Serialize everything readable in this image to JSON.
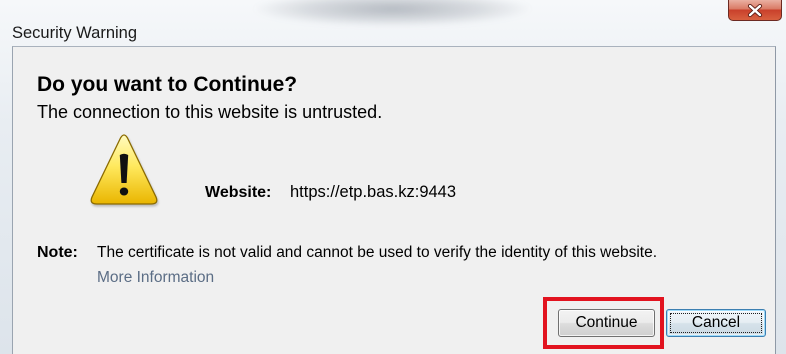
{
  "window": {
    "title": "Security Warning"
  },
  "dialog": {
    "heading": "Do you want to Continue?",
    "message": "The connection to this website is untrusted.",
    "website_label": "Website:",
    "website_url": "https://etp.bas.kz:9443",
    "note_label": "Note:",
    "note_text": "The certificate is not valid and cannot be used to verify the identity of this website.",
    "more_info_link": "More Information"
  },
  "buttons": {
    "continue": "Continue",
    "cancel": "Cancel"
  },
  "icons": {
    "close": "close-icon",
    "warning": "warning-icon"
  },
  "colors": {
    "highlight": "#e2131f",
    "link": "#5b6d85",
    "close_button": "#c9402b",
    "dialog_background": "#f0f0f0",
    "focus_border": "#3c7fb1"
  }
}
